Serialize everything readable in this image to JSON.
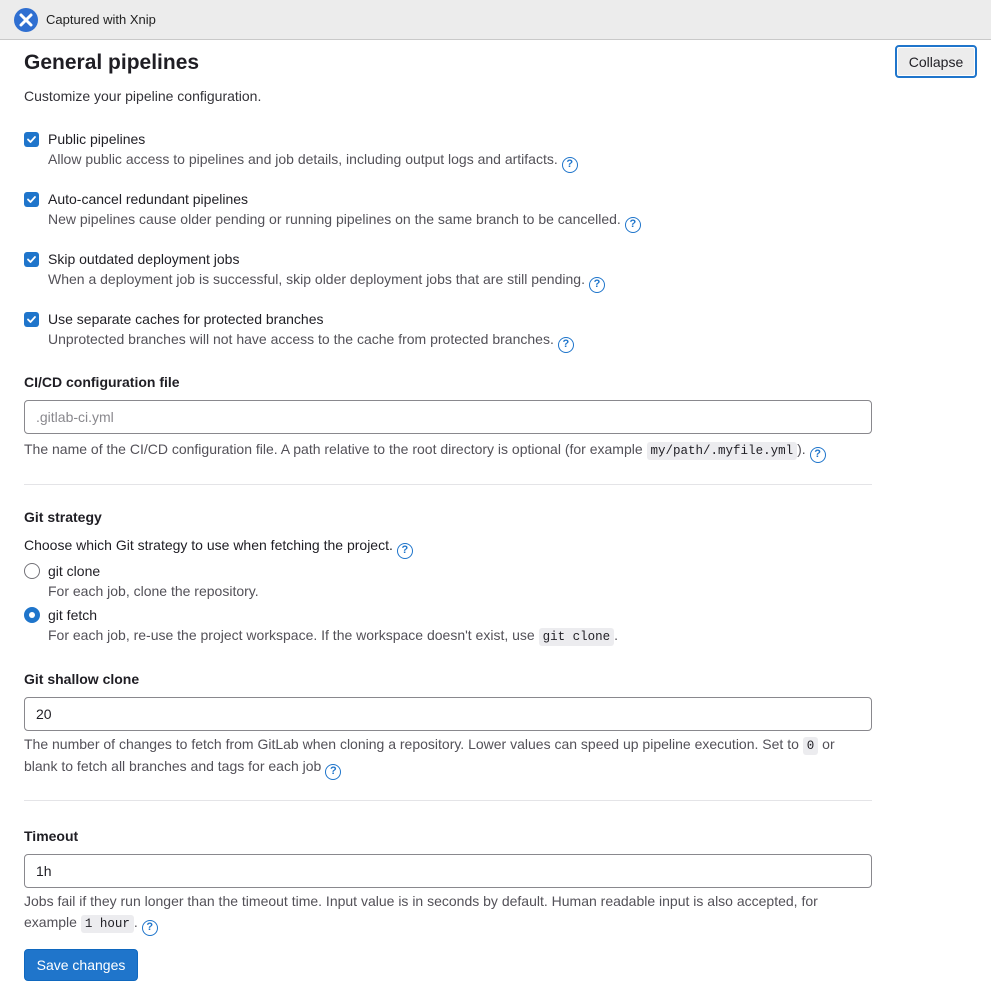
{
  "window": {
    "title": "Captured with Xnip",
    "logo_icon": "xnip-logo-icon"
  },
  "section": {
    "title": "General pipelines",
    "collapse_label": "Collapse",
    "description": "Customize your pipeline configuration."
  },
  "checkboxes": [
    {
      "label": "Public pipelines",
      "help": "Allow public access to pipelines and job details, including output logs and artifacts.",
      "checked": true
    },
    {
      "label": "Auto-cancel redundant pipelines",
      "help": "New pipelines cause older pending or running pipelines on the same branch to be cancelled.",
      "checked": true
    },
    {
      "label": "Skip outdated deployment jobs",
      "help": "When a deployment job is successful, skip older deployment jobs that are still pending.",
      "checked": true
    },
    {
      "label": "Use separate caches for protected branches",
      "help": "Unprotected branches will not have access to the cache from protected branches.",
      "checked": true
    }
  ],
  "ci_config": {
    "title": "CI/CD configuration file",
    "placeholder": ".gitlab-ci.yml",
    "value": "",
    "help_before": "The name of the CI/CD configuration file. A path relative to the root directory is optional (for example",
    "help_code": "my/path/.myfile.yml",
    "help_after": ")."
  },
  "git_strategy": {
    "title": "Git strategy",
    "description": "Choose which Git strategy to use when fetching the project.",
    "options": [
      {
        "label": "git clone",
        "help": "For each job, clone the repository.",
        "selected": false
      },
      {
        "label": "git fetch",
        "help": "For each job, re-use the project workspace. If the workspace doesn't exist, use",
        "help_code": "git clone",
        "help_after": ".",
        "selected": true
      }
    ]
  },
  "shallow_clone": {
    "title": "Git shallow clone",
    "value": "20",
    "help_line1_before": "The number of changes to fetch from GitLab when cloning a repository. Lower values can speed up pipeline execution. Set to",
    "help_line1_code": "0",
    "help_line1_after": "or",
    "help_line2": "blank to fetch all branches and tags for each job"
  },
  "timeout": {
    "title": "Timeout",
    "value": "1h",
    "help_line1": "Jobs fail if they run longer than the timeout time. Input value is in seconds by default. Human readable input is also accepted, for",
    "help_line2_before": "example",
    "help_line2_code": "1 hour",
    "help_line2_after": "."
  },
  "save_label": "Save changes",
  "colors": {
    "accent": "#1f75cb",
    "text": "#333238",
    "muted": "#535158"
  }
}
